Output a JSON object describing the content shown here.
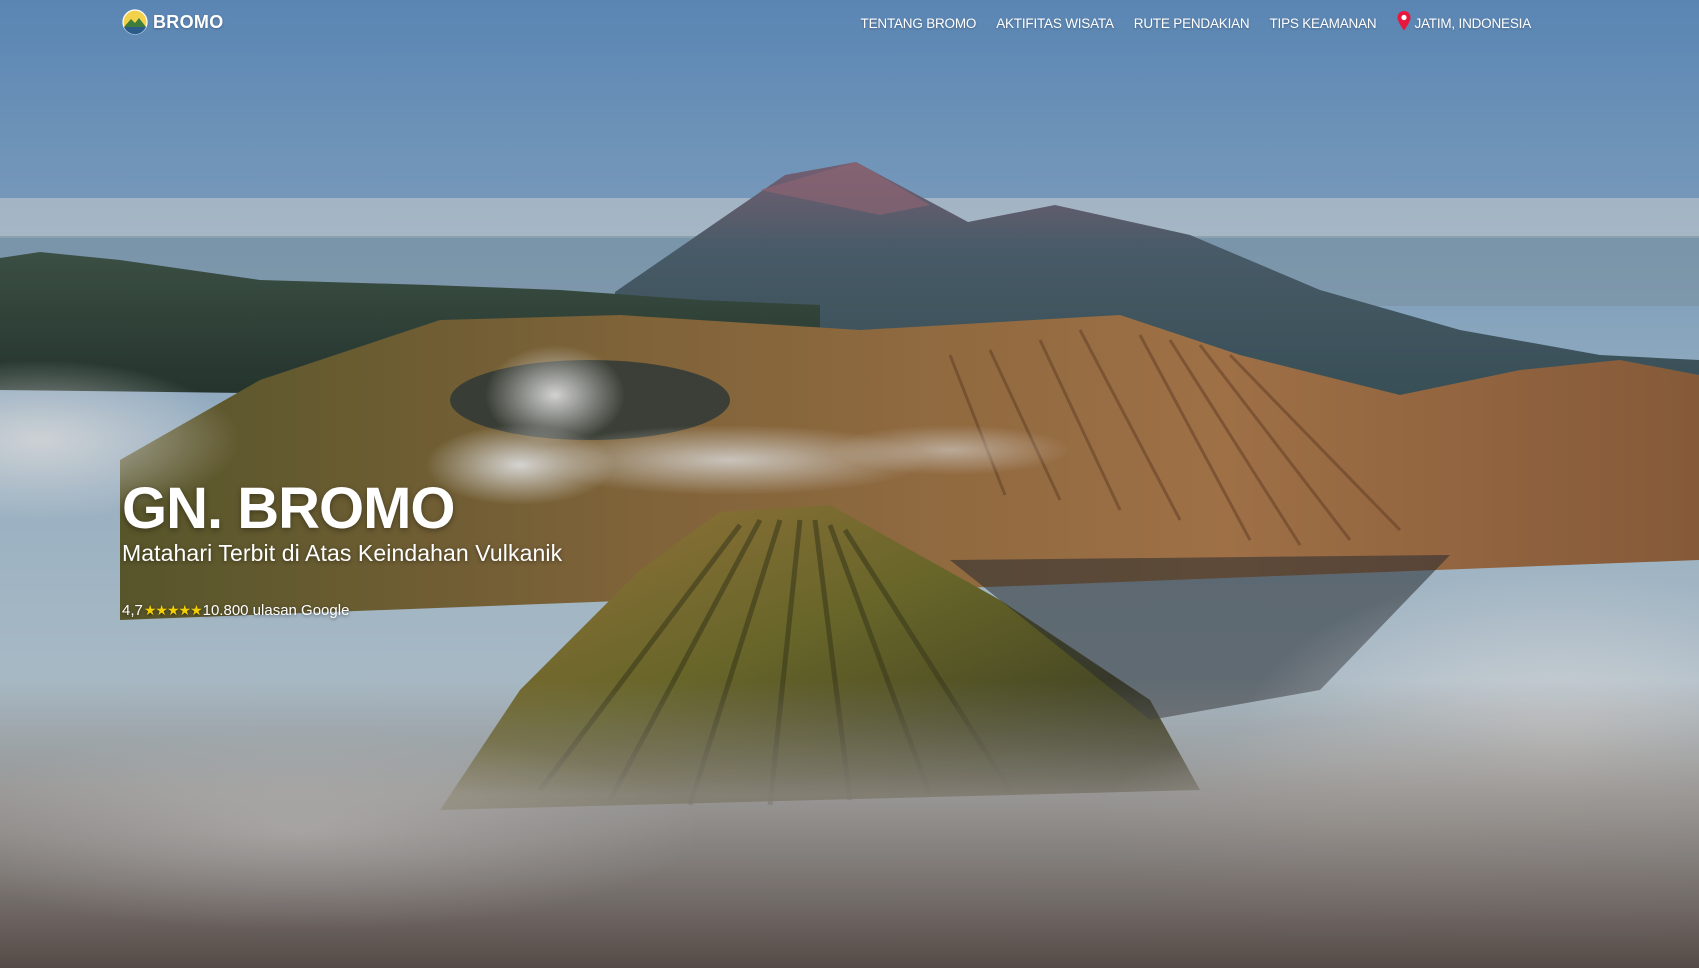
{
  "brand": {
    "name": "BROMO"
  },
  "nav": {
    "items": [
      {
        "label": "TENTANG BROMO"
      },
      {
        "label": "AKTIFITAS WISATA"
      },
      {
        "label": "RUTE PENDAKIAN"
      },
      {
        "label": "TIPS KEAMANAN"
      }
    ],
    "location": "JATIM, INDONESIA"
  },
  "hero": {
    "title": "GN. BROMO",
    "subtitle": "Matahari Terbit di Atas Keindahan Vulkanik",
    "rating_value": "4,7",
    "stars_glyphs": "★★★★★",
    "stars": 4.7,
    "reviews": "10.800 ulasan Google"
  },
  "colors": {
    "star": "#f5d000",
    "pin": "#e8173e",
    "text": "#ffffff"
  },
  "icons": {
    "brand": "mountain-logo-icon",
    "location": "map-pin-icon",
    "star": "star-icon"
  }
}
